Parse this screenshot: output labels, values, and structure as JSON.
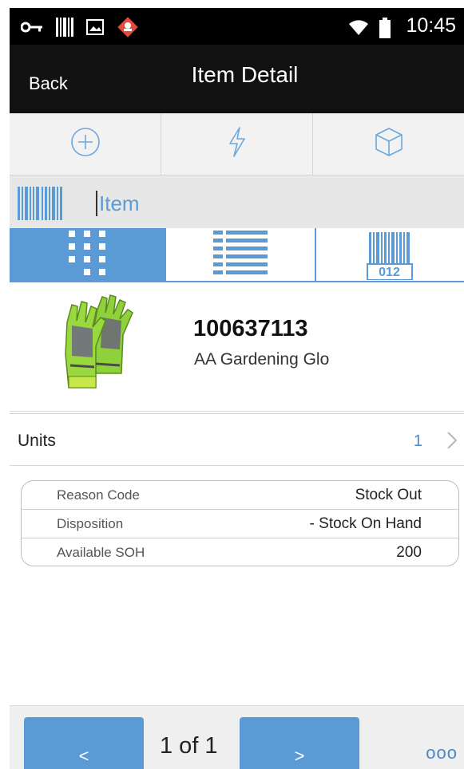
{
  "status_bar": {
    "time": "10:45",
    "icons": [
      "key-icon",
      "barcode-icon",
      "image-icon",
      "alert-app-icon",
      "wifi-icon",
      "battery-icon"
    ]
  },
  "header": {
    "back_label": "Back",
    "title": "Item Detail"
  },
  "toolbar": {
    "buttons": [
      "add-circle-icon",
      "lightning-icon",
      "cube-icon"
    ]
  },
  "scan": {
    "placeholder": "Item"
  },
  "view_tabs": {
    "tabs": [
      "grid-view-icon",
      "list-view-icon",
      "barcode-view-icon"
    ],
    "barcode_tab_text": "012",
    "active_index": 0
  },
  "item": {
    "number": "100637113",
    "description": "AA Gardening Glo",
    "image": "gardening-gloves-image"
  },
  "units": {
    "label": "Units",
    "value": "1"
  },
  "details": [
    {
      "label": "Reason Code",
      "value": "Stock Out"
    },
    {
      "label": "Disposition",
      "value": "- Stock On Hand"
    },
    {
      "label": "Available SOH",
      "value": "200"
    }
  ],
  "pager": {
    "prev_label": "<",
    "next_label": ">",
    "page_text": "1 of 1",
    "more_label": "ooo"
  },
  "colors": {
    "accent": "#5b9bd5",
    "header_bg": "#111111",
    "link": "#4a87c8"
  }
}
